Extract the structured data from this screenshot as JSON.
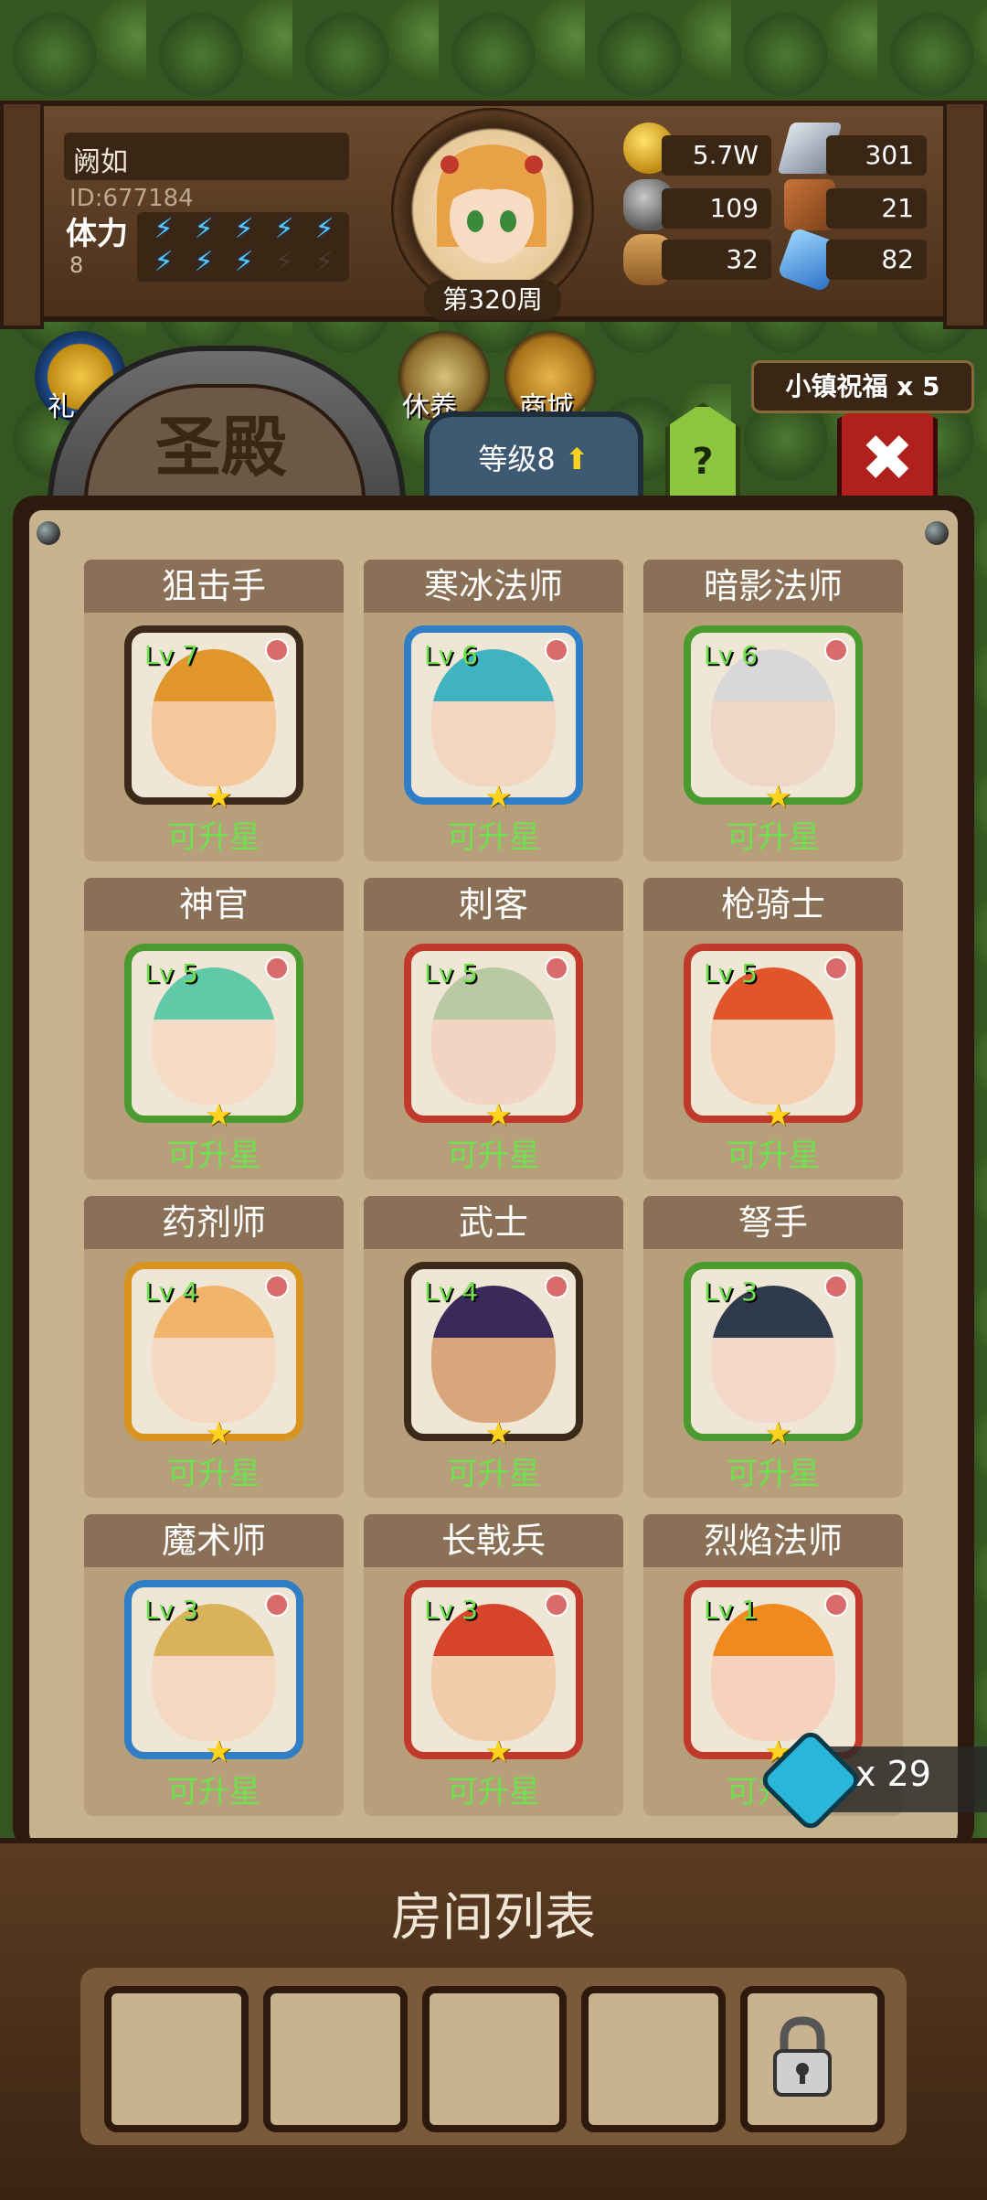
{
  "player": {
    "name": "阙如",
    "id": "ID:677184",
    "stamina_label": "体力",
    "stamina_value": "8",
    "stamina_bolts": [
      true,
      true,
      true,
      true,
      true,
      true,
      true,
      true,
      false,
      false
    ]
  },
  "week": "第320周",
  "resources": {
    "gold": "5.7W",
    "steel": "301",
    "stone": "109",
    "hide": "21",
    "wood": "32",
    "crystal": "82"
  },
  "nav": {
    "rest_label": "休养",
    "shop_label": "商城",
    "partial_left": "礼"
  },
  "header": {
    "title": "圣殿",
    "level_label": "等级8",
    "help": "?",
    "blessing": "小镇祝福 x 5",
    "close": "✖"
  },
  "heroes": [
    {
      "name": "狙击手",
      "level": "Lv 7",
      "status": "可升星",
      "frame": "#3b2a1a",
      "skin": "#f4c89a",
      "hair": "#e0962a"
    },
    {
      "name": "寒冰法师",
      "level": "Lv 6",
      "status": "可升星",
      "frame": "#2f7ec6",
      "skin": "#f3d6c2",
      "hair": "#3fb3c0"
    },
    {
      "name": "暗影法师",
      "level": "Lv 6",
      "status": "可升星",
      "frame": "#4a9a30",
      "skin": "#f0d6c6",
      "hair": "#d8d8d8"
    },
    {
      "name": "神官",
      "level": "Lv 5",
      "status": "可升星",
      "frame": "#4a9a30",
      "skin": "#f6dcc6",
      "hair": "#5fc9a8"
    },
    {
      "name": "刺客",
      "level": "Lv 5",
      "status": "可升星",
      "frame": "#c0392b",
      "skin": "#f1d5c2",
      "hair": "#b9c9a2"
    },
    {
      "name": "枪骑士",
      "level": "Lv 5",
      "status": "可升星",
      "frame": "#c0392b",
      "skin": "#f5cfb0",
      "hair": "#e0552a"
    },
    {
      "name": "药剂师",
      "level": "Lv 4",
      "status": "可升星",
      "frame": "#d9931f",
      "skin": "#f6d8c0",
      "hair": "#f0b46a"
    },
    {
      "name": "武士",
      "level": "Lv 4",
      "status": "可升星",
      "frame": "#3b2a1a",
      "skin": "#d9a57a",
      "hair": "#3a2a5a"
    },
    {
      "name": "弩手",
      "level": "Lv 3",
      "status": "可升星",
      "frame": "#4a9a30",
      "skin": "#f3d8c8",
      "hair": "#2f3a4a"
    },
    {
      "name": "魔术师",
      "level": "Lv 3",
      "status": "可升星",
      "frame": "#2f7ec6",
      "skin": "#f5d8c0",
      "hair": "#d9b25a"
    },
    {
      "name": "长戟兵",
      "level": "Lv 3",
      "status": "可升星",
      "frame": "#c0392b",
      "skin": "#f2ccaa",
      "hair": "#d6452a"
    },
    {
      "name": "烈焰法师",
      "level": "Lv 1",
      "status": "可升星",
      "frame": "#c0392b",
      "skin": "#f6d2bc",
      "hair": "#f08a1e"
    }
  ],
  "scroll_count": "x 29",
  "room": {
    "title": "房间列表",
    "slots": 5
  }
}
